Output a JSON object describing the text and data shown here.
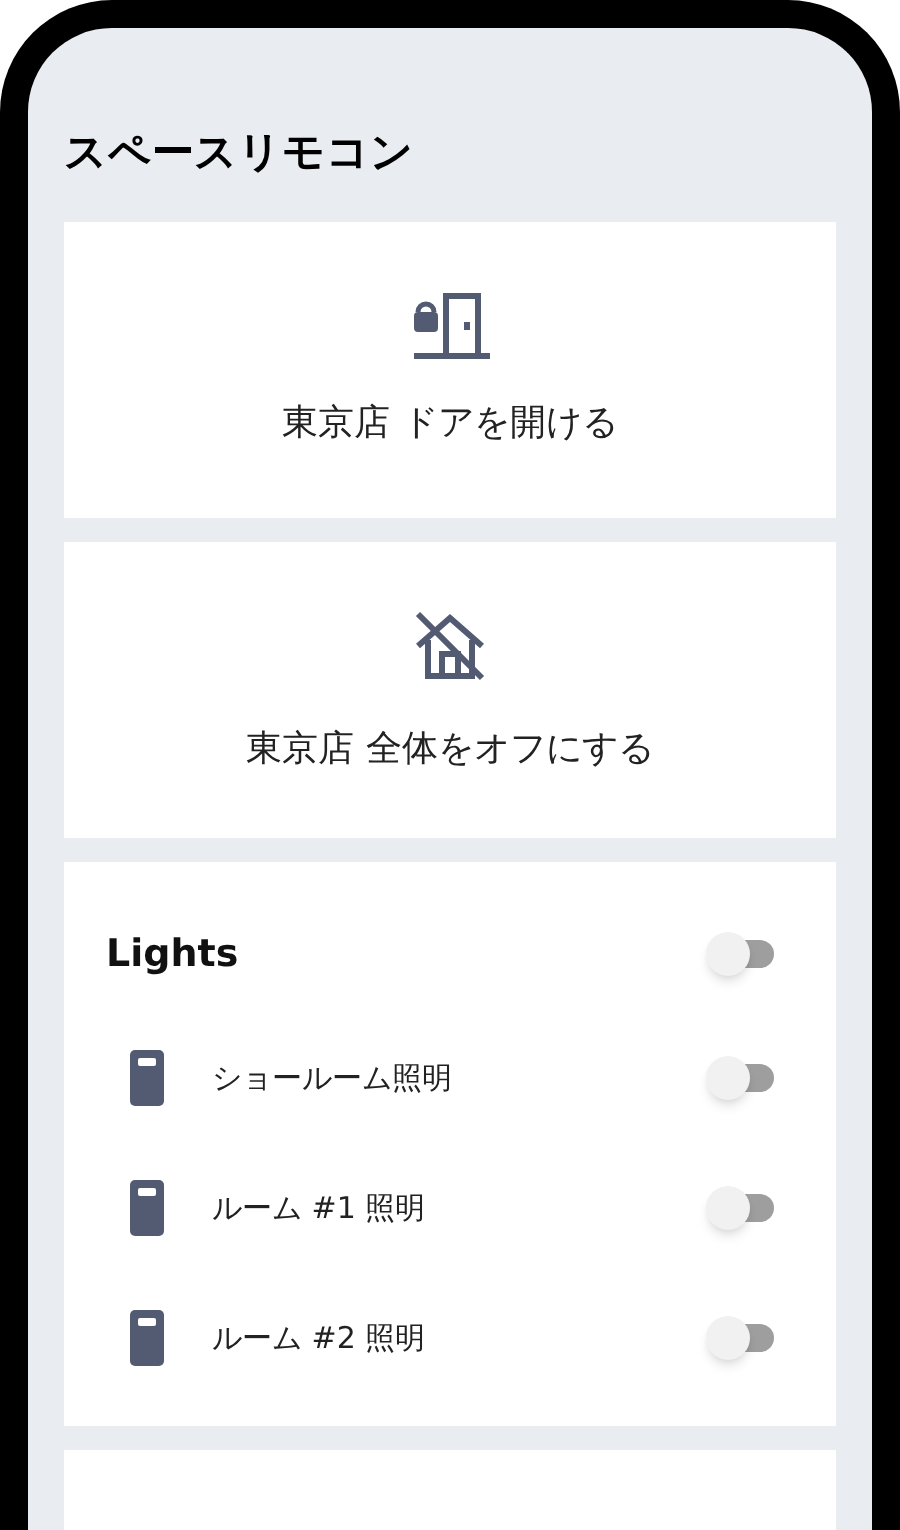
{
  "title": "スペースリモコン",
  "actions": [
    {
      "kind": "door",
      "label": "東京店 ドアを開ける"
    },
    {
      "kind": "house-off",
      "label": "東京店 全体をオフにする"
    }
  ],
  "lights": {
    "title": "Lights",
    "on": false,
    "items": [
      {
        "label": "ショールーム照明",
        "on": false
      },
      {
        "label": "ルーム #1 照明",
        "on": false
      },
      {
        "label": "ルーム #2 照明",
        "on": false
      }
    ]
  }
}
